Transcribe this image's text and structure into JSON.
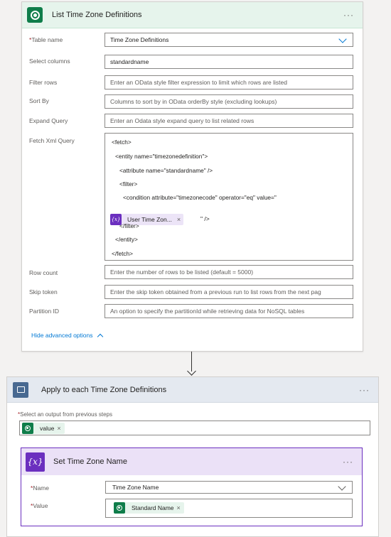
{
  "list_action": {
    "title": "List Time Zone Definitions",
    "more": "···",
    "fields": {
      "table_name": {
        "required": "*",
        "label": "Table name",
        "value": "Time Zone Definitions"
      },
      "select_columns": {
        "label": "Select columns",
        "value": "standardname"
      },
      "filter_rows": {
        "label": "Filter rows",
        "placeholder": "Enter an OData style filter expression to limit which rows are listed"
      },
      "sort_by": {
        "label": "Sort By",
        "placeholder": "Columns to sort by in OData orderBy style (excluding lookups)"
      },
      "expand_query": {
        "label": "Expand Query",
        "placeholder": "Enter an Odata style expand query to list related rows"
      },
      "fetch_xml": {
        "label": "Fetch Xml Query",
        "lines": [
          "<fetch>",
          "<entity name=\"timezonedefinition\">",
          "<attribute name=\"standardname\" />",
          "<filter>",
          "<condition attribute=\"timezonecode\" operator=\"eq\" value=\"",
          "</filter>",
          "</entity>",
          "</fetch>"
        ],
        "token": {
          "icon": "{x}",
          "label": "User Time Zon...",
          "remove": "×"
        },
        "after_token": "\" />"
      },
      "row_count": {
        "label": "Row count",
        "placeholder": "Enter the number of rows to be listed (default = 5000)"
      },
      "skip_token": {
        "label": "Skip token",
        "placeholder": "Enter the skip token obtained from a previous run to list rows from the next pag"
      },
      "partition_id": {
        "label": "Partition ID",
        "placeholder": "An option to specify the partitionId while retrieving data for NoSQL tables"
      }
    },
    "hide_advanced": "Hide advanced options"
  },
  "apply_each": {
    "title": "Apply to each Time Zone Definitions",
    "more": "···",
    "select_label_required": "*",
    "select_label": "Select an output from previous steps",
    "chip": {
      "label": "value",
      "remove": "×"
    }
  },
  "set_variable": {
    "title": "Set Time Zone Name",
    "icon": "{x}",
    "more": "···",
    "name": {
      "required": "*",
      "label": "Name",
      "value": "Time Zone Name"
    },
    "value": {
      "required": "*",
      "label": "Value",
      "chip": {
        "label": "Standard Name",
        "remove": "×"
      }
    }
  },
  "colors": {
    "dataverse_green": "#0f7d4a",
    "variable_purple": "#6b2fbf",
    "loop_blue": "#486991",
    "link_blue": "#0078d4"
  }
}
